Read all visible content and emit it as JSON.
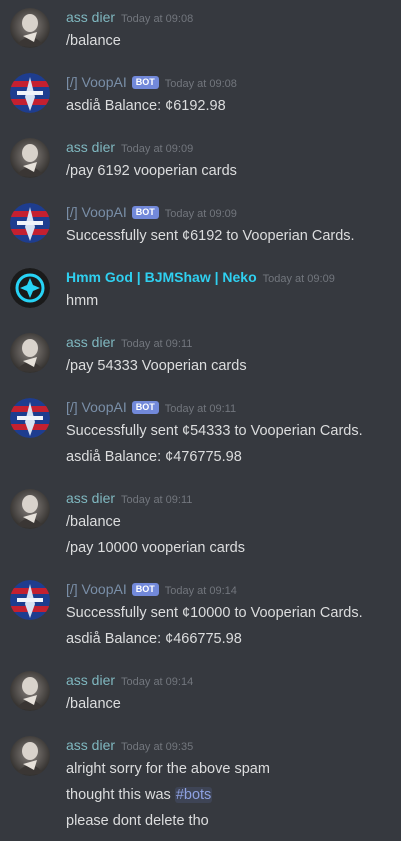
{
  "messages": [
    {
      "author": "ass dier",
      "type": "user",
      "time": "Today at 09:08",
      "lines": [
        "/balance"
      ]
    },
    {
      "author": "[/] VoopAI",
      "type": "bot",
      "badge": "BOT",
      "time": "Today at 09:08",
      "lines": [
        "asdiå Balance: ¢6192.98"
      ]
    },
    {
      "author": "ass dier",
      "type": "user",
      "time": "Today at 09:09",
      "lines": [
        "/pay 6192 vooperian cards"
      ]
    },
    {
      "author": "[/] VoopAI",
      "type": "bot",
      "badge": "BOT",
      "time": "Today at 09:09",
      "lines": [
        "Successfully sent ¢6192 to Vooperian Cards."
      ]
    },
    {
      "author": "Hmm God | BJMShaw | Neko",
      "type": "neko",
      "time": "Today at 09:09",
      "lines": [
        "hmm"
      ]
    },
    {
      "author": "ass dier",
      "type": "user",
      "time": "Today at 09:11",
      "lines": [
        "/pay 54333 Vooperian cards"
      ]
    },
    {
      "author": "[/] VoopAI",
      "type": "bot",
      "badge": "BOT",
      "time": "Today at 09:11",
      "lines": [
        "Successfully sent ¢54333 to Vooperian Cards.",
        "asdiå Balance: ¢476775.98"
      ]
    },
    {
      "author": "ass dier",
      "type": "user",
      "time": "Today at 09:11",
      "lines": [
        "/balance",
        "/pay 10000 vooperian cards"
      ]
    },
    {
      "author": "[/] VoopAI",
      "type": "bot",
      "badge": "BOT",
      "time": "Today at 09:14",
      "lines": [
        "Successfully sent ¢10000 to Vooperian Cards.",
        "asdiå Balance: ¢466775.98"
      ]
    },
    {
      "author": "ass dier",
      "type": "user",
      "time": "Today at 09:14",
      "lines": [
        "/balance"
      ]
    },
    {
      "author": "ass dier",
      "type": "user",
      "time": "Today at 09:35",
      "lines": [
        "alright sorry for the above spam",
        "thought this was ",
        "please dont delete tho"
      ]
    }
  ],
  "channel_mention": "#bots",
  "colors": {
    "background": "#36393f",
    "user_name": "#7fb7bf",
    "bot_name": "#7a8fa8",
    "neko_name": "#2fd0f0",
    "bot_badge": "#7289da",
    "timestamp": "#72767d",
    "text": "#dcddde",
    "mention": "#8ea1e1"
  },
  "icons": {
    "user": "user-avatar-icon",
    "bot": "voopai-avatar-icon",
    "neko": "neko-avatar-icon"
  }
}
